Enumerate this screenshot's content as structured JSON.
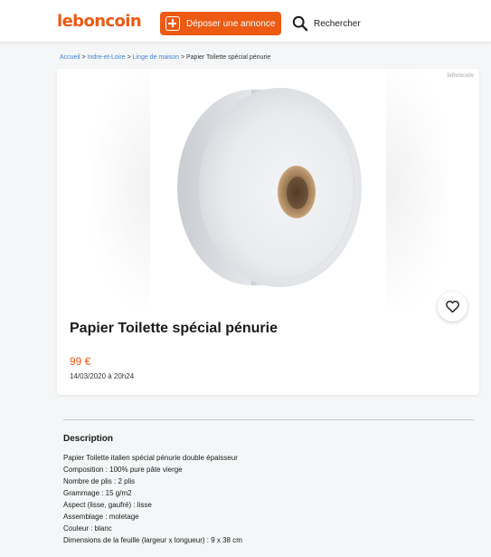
{
  "header": {
    "logo": "leboncoin",
    "post_button_label": "Déposer une annonce",
    "search_label": "Rechercher"
  },
  "breadcrumb": {
    "items": [
      "Accueil",
      "Indre-et-Loire",
      "Linge de maison"
    ],
    "current": "Papier Toilette spécial pénurie",
    "separator": ">"
  },
  "listing": {
    "watermark": "leboncoin",
    "title": "Papier Toilette spécial pénurie",
    "price": "99 €",
    "date": "14/03/2020 à 20h24"
  },
  "description": {
    "heading": "Description",
    "lines": [
      "Papier Toilette italien spécial pénurie double épaisseur",
      "Composition : 100% pure pâte vierge",
      "Nombre de plis : 2 plis",
      "Grammage : 15 g/m2",
      "Aspect (lisse, gaufré) : lisse",
      "Assemblage : moletage",
      "Couleur : blanc",
      "Dimensions de la feuille (largeur x longueur) : 9 x 38 cm"
    ]
  },
  "colors": {
    "brand": "#ec5a13",
    "link": "#4183d7",
    "background": "#f4f6f7"
  },
  "icons": {
    "post": "plus-square-icon",
    "search": "search-icon",
    "favorite": "heart-icon"
  }
}
